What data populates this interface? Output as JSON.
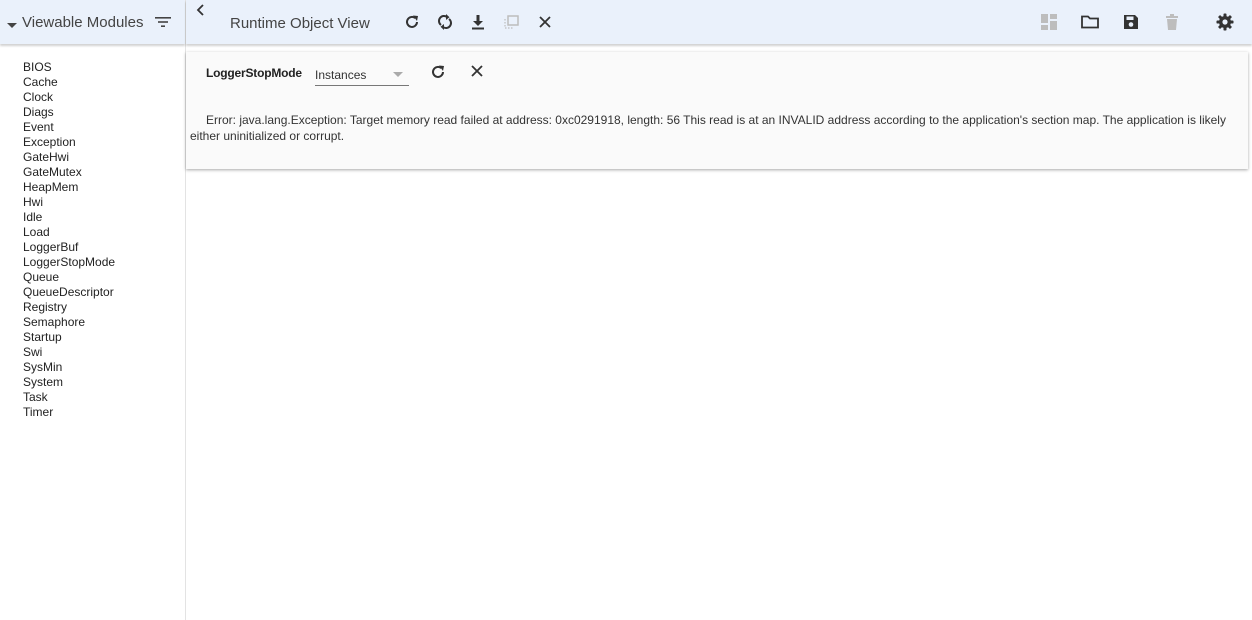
{
  "sidebar": {
    "title": "Viewable Modules",
    "caret_icon": "caret-down-icon",
    "filter_icon": "filter-icon",
    "modules": [
      "BIOS",
      "Cache",
      "Clock",
      "Diags",
      "Event",
      "Exception",
      "GateHwi",
      "GateMutex",
      "HeapMem",
      "Hwi",
      "Idle",
      "Load",
      "LoggerBuf",
      "LoggerStopMode",
      "Queue",
      "QueueDescriptor",
      "Registry",
      "Semaphore",
      "Startup",
      "Swi",
      "SysMin",
      "System",
      "Task",
      "Timer"
    ]
  },
  "toolbar": {
    "title": "Runtime Object View",
    "collapse_icon": "chevron-left-icon",
    "left_icons": [
      "refresh-icon",
      "continuous-refresh-icon",
      "download-icon",
      "clone-icon",
      "close-icon"
    ],
    "right_icons": [
      "layout-icon",
      "folder-open-icon",
      "save-icon",
      "delete-icon",
      "gear-icon"
    ],
    "colors": {
      "background": "#eaf1fb",
      "icon": "#333333",
      "icon_disabled": "#bdbdbd"
    }
  },
  "panel": {
    "module": "LoggerStopMode",
    "view_selected": "Instances",
    "error": "Error: java.lang.Exception: Target memory read failed at address: 0xc0291918, length: 56 This read is at an INVALID address according to the application's section map. The application is likely either uninitialized or corrupt."
  }
}
